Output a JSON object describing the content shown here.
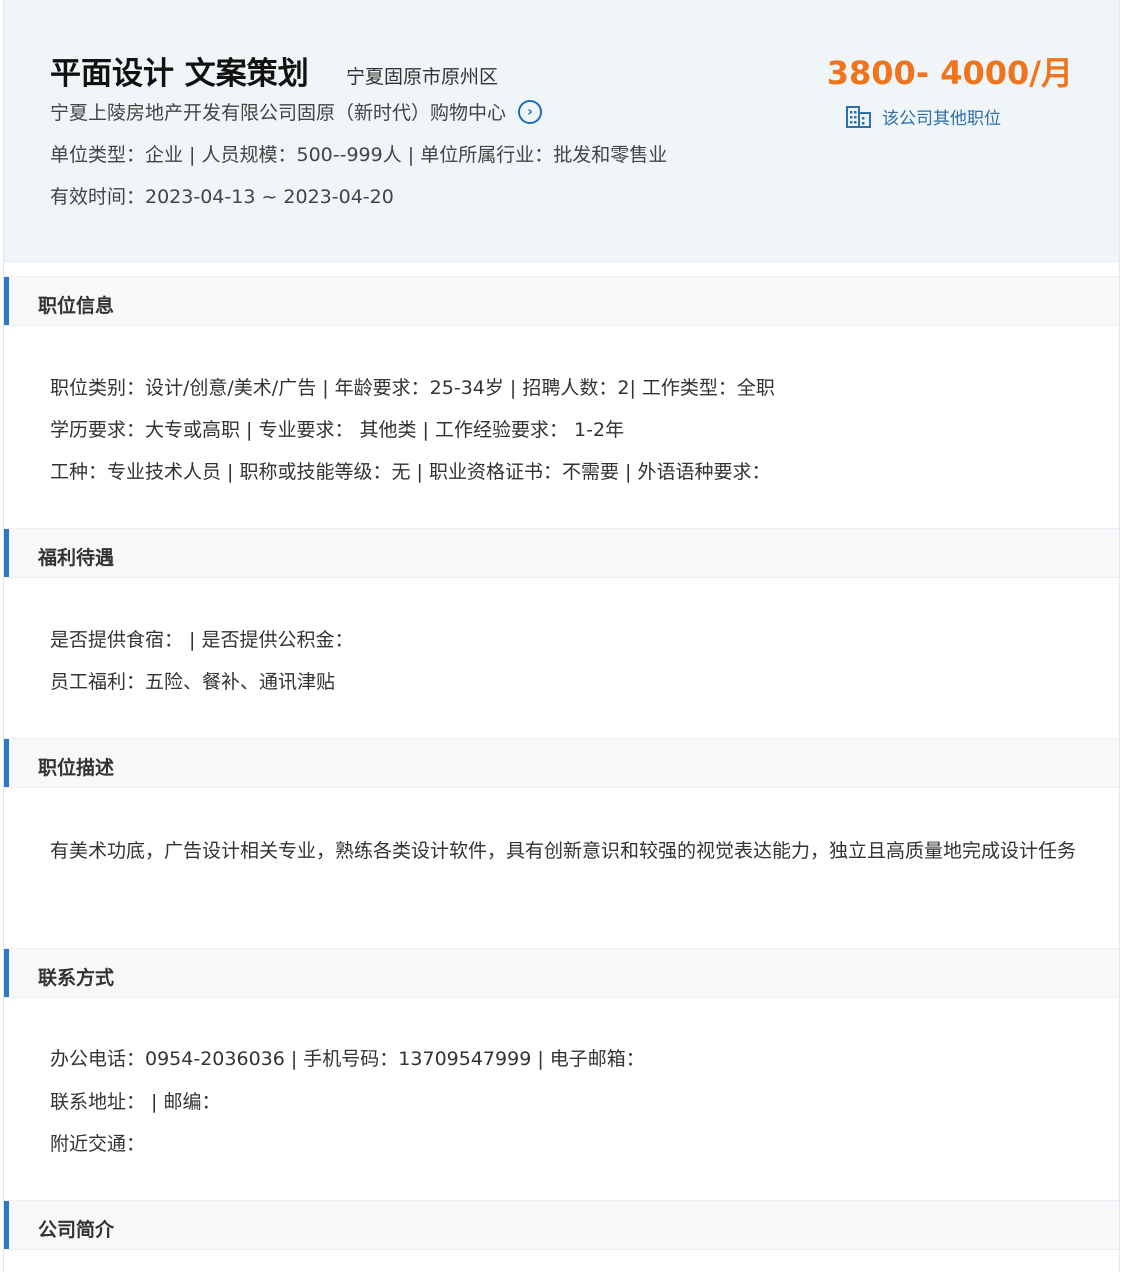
{
  "header": {
    "title": "平面设计 文案策划",
    "location": "宁夏固原市原州区",
    "company": "宁夏上陵房地产开发有限公司固原（新时代）购物中心",
    "company_link_icon": "chevron-right-circle-icon",
    "meta": "单位类型：企业 | 人员规模：500--999人 | 单位所属行业：批发和零售业",
    "valid": "有效时间：2023-04-13 ~ 2023-04-20",
    "salary": "3800- 4000/月",
    "other_jobs": "该公司其他职位",
    "other_jobs_icon": "building-icon"
  },
  "colors": {
    "accent": "#2c78c2",
    "salary": "#f0731d",
    "link": "#2d6fa8",
    "header_bg": "#f0f5f8"
  },
  "sections": {
    "position_info": {
      "title": "职位信息",
      "lines": [
        "职位类别：设计/创意/美术/广告 | 年龄要求：25-34岁 | 招聘人数：2| 工作类型：全职",
        "学历要求：大专或高职 | 专业要求： 其他类 | 工作经验要求： 1-2年",
        "工种：专业技术人员 | 职称或技能等级：无 | 职业资格证书：不需要 | 外语语种要求："
      ]
    },
    "benefits": {
      "title": "福利待遇",
      "lines": [
        "是否提供食宿： | 是否提供公积金：",
        "员工福利：五险、餐补、通讯津贴"
      ]
    },
    "description": {
      "title": "职位描述",
      "text": "有美术功底，广告设计相关专业，熟练各类设计软件，具有创新意识和较强的视觉表达能力，独立且高质量地完成设计任务"
    },
    "contact": {
      "title": "联系方式",
      "lines": [
        "办公电话：0954-2036036 | 手机号码：13709547999 | 电子邮箱：",
        "联系地址： | 邮编：",
        "附近交通："
      ]
    },
    "company_intro": {
      "title": "公司简介"
    }
  }
}
